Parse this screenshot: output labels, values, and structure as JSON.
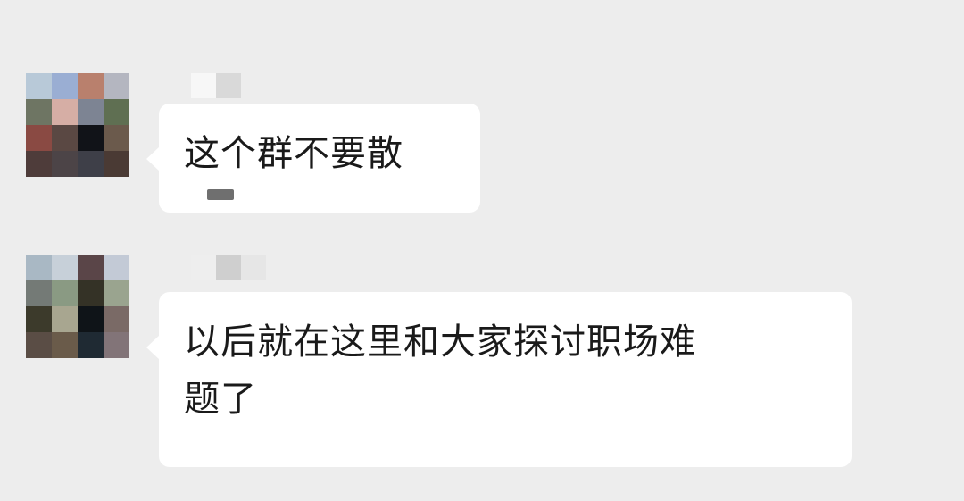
{
  "chat": {
    "messages": [
      {
        "sender": "",
        "text": "这个群不要散",
        "avatar_colors": [
          "#b8c9d8",
          "#9aaed3",
          "#b9806d",
          "#b4b6c0",
          "#6e7563",
          "#d6aea5",
          "#7d8493",
          "#5f6f52",
          "#8a4a43",
          "#5a4843",
          "#111318",
          "#6b5a4c",
          "#4e3c3a",
          "#4c4447",
          "#3e3f48",
          "#4a3a34"
        ],
        "nickname_colors": [
          "#ededed",
          "#f7f7f7",
          "#d9d9d9",
          "#ededed"
        ]
      },
      {
        "sender": "",
        "text": "以后就在这里和大家探讨职场难\n题了",
        "avatar_colors": [
          "#a9b8c4",
          "#c7d0d9",
          "#5a4548",
          "#c3cad6",
          "#747a76",
          "#8a9a83",
          "#343226",
          "#9aa48f",
          "#3c3a2b",
          "#a8a690",
          "#0f1418",
          "#7a6a66",
          "#5a4d45",
          "#6a5b4a",
          "#1f2a33",
          "#827478"
        ],
        "nickname_colors": [
          "#ededed",
          "#eeeeee",
          "#cfcfcf",
          "#e6e6e6"
        ]
      }
    ],
    "colors": {
      "background": "#ededed",
      "bubble": "#ffffff",
      "text": "#1a1a1a"
    }
  }
}
